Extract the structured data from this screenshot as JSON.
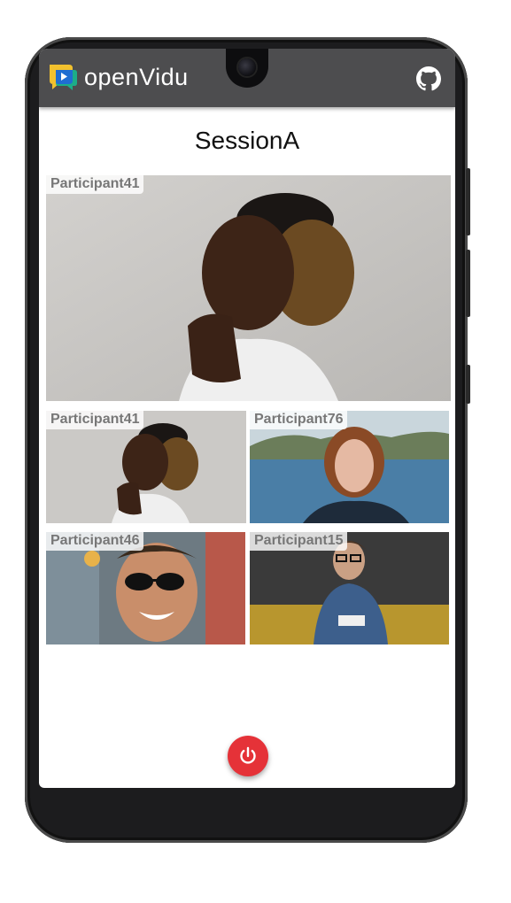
{
  "app": {
    "brand": "openVidu",
    "logo_icon": "openvidu-logo-icon",
    "github_icon": "github-icon"
  },
  "session": {
    "title": "SessionA"
  },
  "main_video": {
    "nickname": "Participant41"
  },
  "participants": [
    {
      "nickname": "Participant41"
    },
    {
      "nickname": "Participant76"
    },
    {
      "nickname": "Participant46"
    },
    {
      "nickname": "Participant15"
    }
  ],
  "controls": {
    "leave_icon": "power-icon",
    "leave_color": "#e53238"
  },
  "colors": {
    "toolbar": "#4d4d4f",
    "logo_yellow": "#f2c12e",
    "logo_green": "#19b28b",
    "logo_blue": "#1f6dd1"
  }
}
